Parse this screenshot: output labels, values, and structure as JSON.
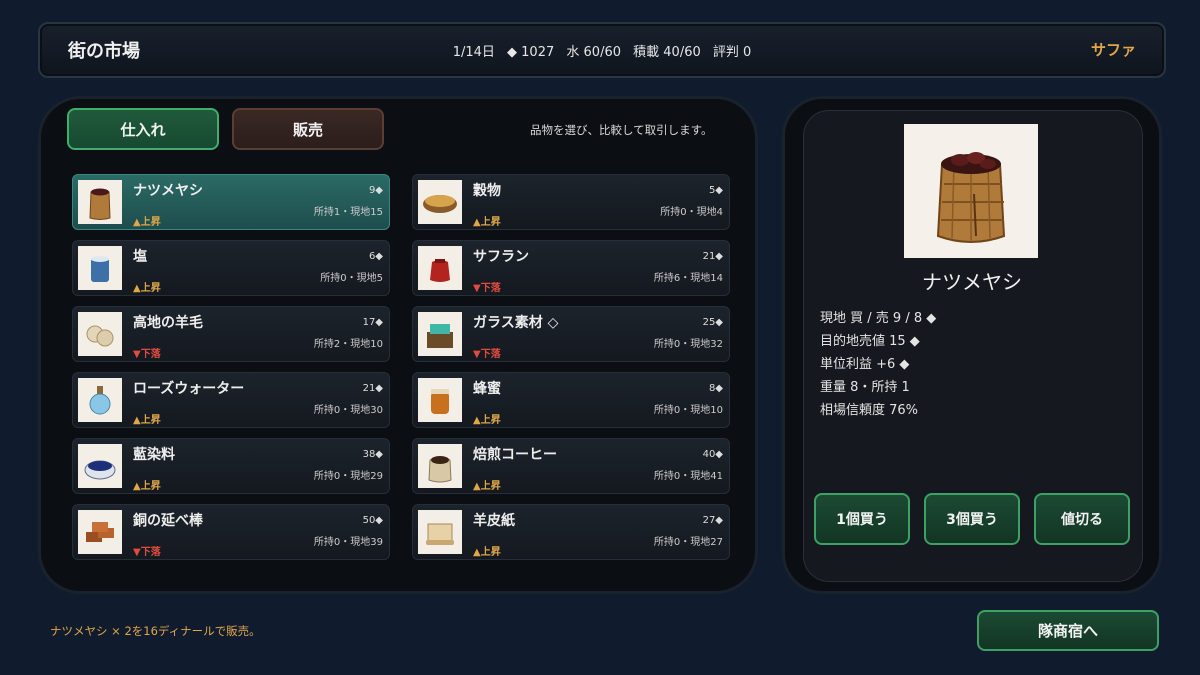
{
  "header": {
    "title": "街の市場",
    "date": "1/14日",
    "money": "◆ 1027",
    "water": "水 60/60",
    "cargo": "積載 40/60",
    "reputation": "評判 0",
    "city": "サファ"
  },
  "tabs": {
    "buy": "仕入れ",
    "sell": "販売"
  },
  "hint": "品物を選び、比較して取引します。",
  "items": [
    {
      "name": "ナツメヤシ",
      "price": "9◆",
      "held": "所持1・現地15",
      "trend": "▲上昇",
      "trend_dir": "up",
      "icon": "dates-sack-icon"
    },
    {
      "name": "穀物",
      "price": "5◆",
      "held": "所持0・現地4",
      "trend": "▲上昇",
      "trend_dir": "up",
      "icon": "grain-bowl-icon"
    },
    {
      "name": "塩",
      "price": "6◆",
      "held": "所持0・現地5",
      "trend": "▲上昇",
      "trend_dir": "up",
      "icon": "salt-jar-icon"
    },
    {
      "name": "サフラン",
      "price": "21◆",
      "held": "所持6・現地14",
      "trend": "▼下落",
      "trend_dir": "down",
      "icon": "saffron-pouch-icon"
    },
    {
      "name": "高地の羊毛",
      "price": "17◆",
      "held": "所持2・現地10",
      "trend": "▼下落",
      "trend_dir": "down",
      "icon": "wool-bundle-icon"
    },
    {
      "name": "ガラス素材 ◇",
      "price": "25◆",
      "held": "所持0・現地32",
      "trend": "▼下落",
      "trend_dir": "down",
      "icon": "glass-crate-icon"
    },
    {
      "name": "ローズウォーター",
      "price": "21◆",
      "held": "所持0・現地30",
      "trend": "▲上昇",
      "trend_dir": "up",
      "icon": "rosewater-bottle-icon"
    },
    {
      "name": "蜂蜜",
      "price": "8◆",
      "held": "所持0・現地10",
      "trend": "▲上昇",
      "trend_dir": "up",
      "icon": "honey-jar-icon"
    },
    {
      "name": "藍染料",
      "price": "38◆",
      "held": "所持0・現地29",
      "trend": "▲上昇",
      "trend_dir": "up",
      "icon": "indigo-bowl-icon"
    },
    {
      "name": "焙煎コーヒー",
      "price": "40◆",
      "held": "所持0・現地41",
      "trend": "▲上昇",
      "trend_dir": "up",
      "icon": "coffee-sack-icon"
    },
    {
      "name": "銅の延べ棒",
      "price": "50◆",
      "held": "所持0・現地39",
      "trend": "▼下落",
      "trend_dir": "down",
      "icon": "copper-ingot-icon"
    },
    {
      "name": "羊皮紙",
      "price": "27◆",
      "held": "所持0・現地27",
      "trend": "▲上昇",
      "trend_dir": "up",
      "icon": "parchment-scroll-icon"
    }
  ],
  "detail": {
    "name": "ナツメヤシ",
    "icon": "dates-sack-icon",
    "rows": [
      "現地 買 / 売  9 / 8 ◆",
      "目的地売値  15 ◆",
      "単位利益  +6 ◆",
      "重量  8・所持 1",
      "相場信頼度  76%"
    ],
    "buttons": {
      "buy1": "1個買う",
      "buy3": "3個買う",
      "haggle": "値切る"
    }
  },
  "footer": {
    "message": "ナツメヤシ × 2を16ディナールで販売。",
    "inn_button": "隊商宿へ"
  },
  "colors": {
    "accent_gold": "#e0a64a",
    "up": "#e0a64a",
    "down": "#e24b3f",
    "green_border": "#3da065",
    "selected": "#2b6a66"
  }
}
